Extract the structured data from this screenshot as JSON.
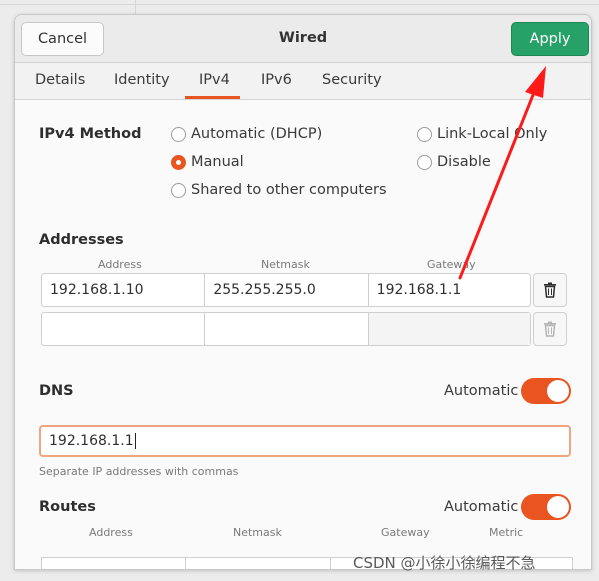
{
  "header": {
    "title": "Wired",
    "cancel_label": "Cancel",
    "apply_label": "Apply"
  },
  "tabs": [
    {
      "label": "Details",
      "active": false
    },
    {
      "label": "Identity",
      "active": false
    },
    {
      "label": "IPv4",
      "active": true
    },
    {
      "label": "IPv6",
      "active": false
    },
    {
      "label": "Security",
      "active": false
    }
  ],
  "ipv4_method": {
    "label": "IPv4 Method",
    "options": [
      {
        "label": "Automatic (DHCP)",
        "checked": false
      },
      {
        "label": "Link-Local Only",
        "checked": false
      },
      {
        "label": "Manual",
        "checked": true
      },
      {
        "label": "Disable",
        "checked": false
      },
      {
        "label": "Shared to other computers",
        "checked": false
      }
    ]
  },
  "addresses": {
    "label": "Addresses",
    "columns": [
      "Address",
      "Netmask",
      "Gateway"
    ],
    "rows": [
      {
        "address": "192.168.1.10",
        "netmask": "255.255.255.0",
        "gateway": "192.168.1.1"
      },
      {
        "address": "",
        "netmask": "",
        "gateway": ""
      }
    ]
  },
  "dns": {
    "label": "DNS",
    "automatic_label": "Automatic",
    "automatic_on": true,
    "value": "192.168.1.1",
    "hint": "Separate IP addresses with commas"
  },
  "routes": {
    "label": "Routes",
    "automatic_label": "Automatic",
    "automatic_on": true,
    "columns": [
      "Address",
      "Netmask",
      "Gateway",
      "Metric"
    ]
  },
  "annotation": {
    "color": "#ff1a1a"
  },
  "watermark": "CSDN @小徐小徐编程不急",
  "colors": {
    "accent": "#e95420",
    "apply_green": "#26a269"
  }
}
